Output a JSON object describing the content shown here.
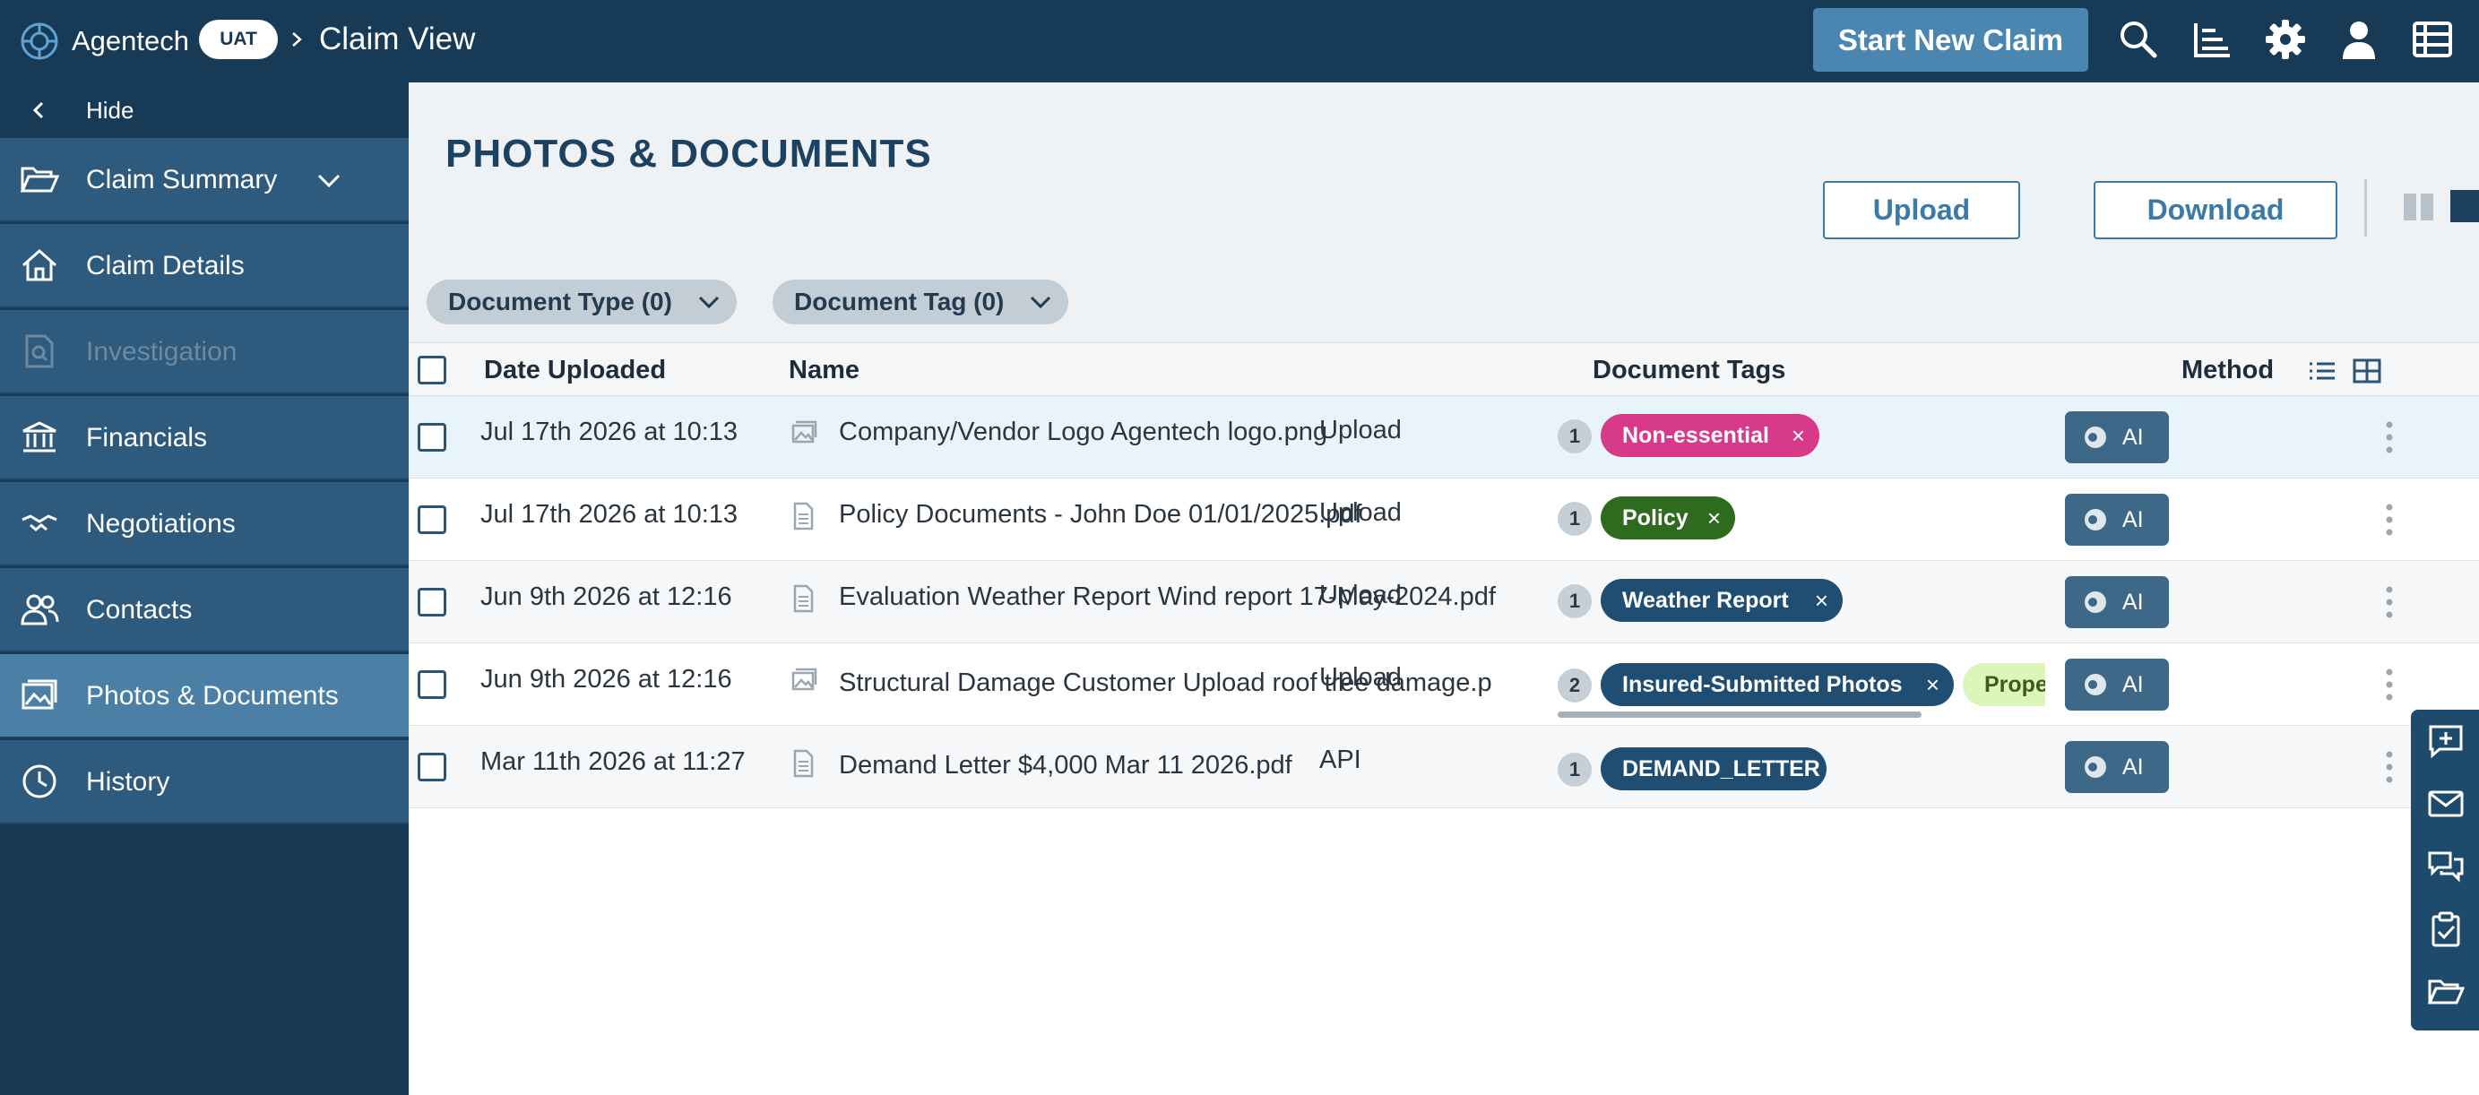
{
  "topbar": {
    "brand": "Agentech",
    "env_badge": "UAT",
    "page_title": "Claim View",
    "start_button": "Start New Claim",
    "icons": [
      "search-icon",
      "reports-icon",
      "settings-icon",
      "user-icon",
      "table-icon"
    ]
  },
  "sidebar": {
    "hide_label": "Hide",
    "items": [
      {
        "label": "Claim Summary",
        "icon": "folder-open-icon",
        "state": "expandable"
      },
      {
        "label": "Claim Details",
        "icon": "house-icon",
        "state": "normal"
      },
      {
        "label": "Investigation",
        "icon": "document-search-icon",
        "state": "disabled"
      },
      {
        "label": "Financials",
        "icon": "bank-icon",
        "state": "normal"
      },
      {
        "label": "Negotiations",
        "icon": "handshake-icon",
        "state": "normal"
      },
      {
        "label": "Contacts",
        "icon": "people-icon",
        "state": "normal"
      },
      {
        "label": "Photos & Documents",
        "icon": "photos-icon",
        "state": "active"
      },
      {
        "label": "History",
        "icon": "clock-icon",
        "state": "normal"
      }
    ]
  },
  "main": {
    "title": "PHOTOS & DOCUMENTS",
    "upload_button": "Upload",
    "download_button": "Download",
    "filters": {
      "doc_type": "Document Type (0)",
      "doc_tag": "Document Tag (0)"
    },
    "columns": {
      "date": "Date Uploaded",
      "name": "Name",
      "tags": "Document Tags",
      "method": "Method"
    },
    "ai_label": "AI",
    "rows": [
      {
        "date": "Jul 17th 2026 at 10:13",
        "name": "Company/Vendor Logo Agentech logo.png",
        "file_type": "image-file-icon",
        "tag_count": "1",
        "tag": "Non-essential",
        "tag_color": "#d63a88",
        "extra_tag": "",
        "method": "Upload"
      },
      {
        "date": "Jul 17th 2026 at 10:13",
        "name": "Policy Documents - John Doe 01/01/2025.pdf",
        "file_type": "document-file-icon",
        "tag_count": "1",
        "tag": "Policy",
        "tag_color": "#2f6b1e",
        "extra_tag": "",
        "method": "Upload"
      },
      {
        "date": "Jun 9th 2026 at 12:16",
        "name": "Evaluation Weather Report Wind report 17-May-2024.pdf",
        "file_type": "document-file-icon",
        "tag_count": "1",
        "tag": "Weather Report",
        "tag_color": "#1f4e72",
        "extra_tag": "",
        "method": "Upload"
      },
      {
        "date": "Jun 9th 2026 at 12:16",
        "name": "Structural Damage Customer Upload roof tree damage.p",
        "file_type": "image-file-icon",
        "tag_count": "2",
        "tag": "Insured-Submitted Photos",
        "tag_color": "#1f4e72",
        "extra_tag": "Prope",
        "method": "Upload"
      },
      {
        "date": "Mar 11th 2026 at 11:27",
        "name": "Demand Letter $4,000 Mar 11 2026.pdf",
        "file_type": "document-file-icon",
        "tag_count": "1",
        "tag": "DEMAND_LETTER",
        "tag_color": "#1f4e72",
        "extra_tag": "",
        "method": "API"
      }
    ]
  },
  "float_panel": {
    "icons": [
      "add-note-icon",
      "mail-icon",
      "chat-icon",
      "clipboard-check-icon",
      "folder-icon"
    ]
  }
}
